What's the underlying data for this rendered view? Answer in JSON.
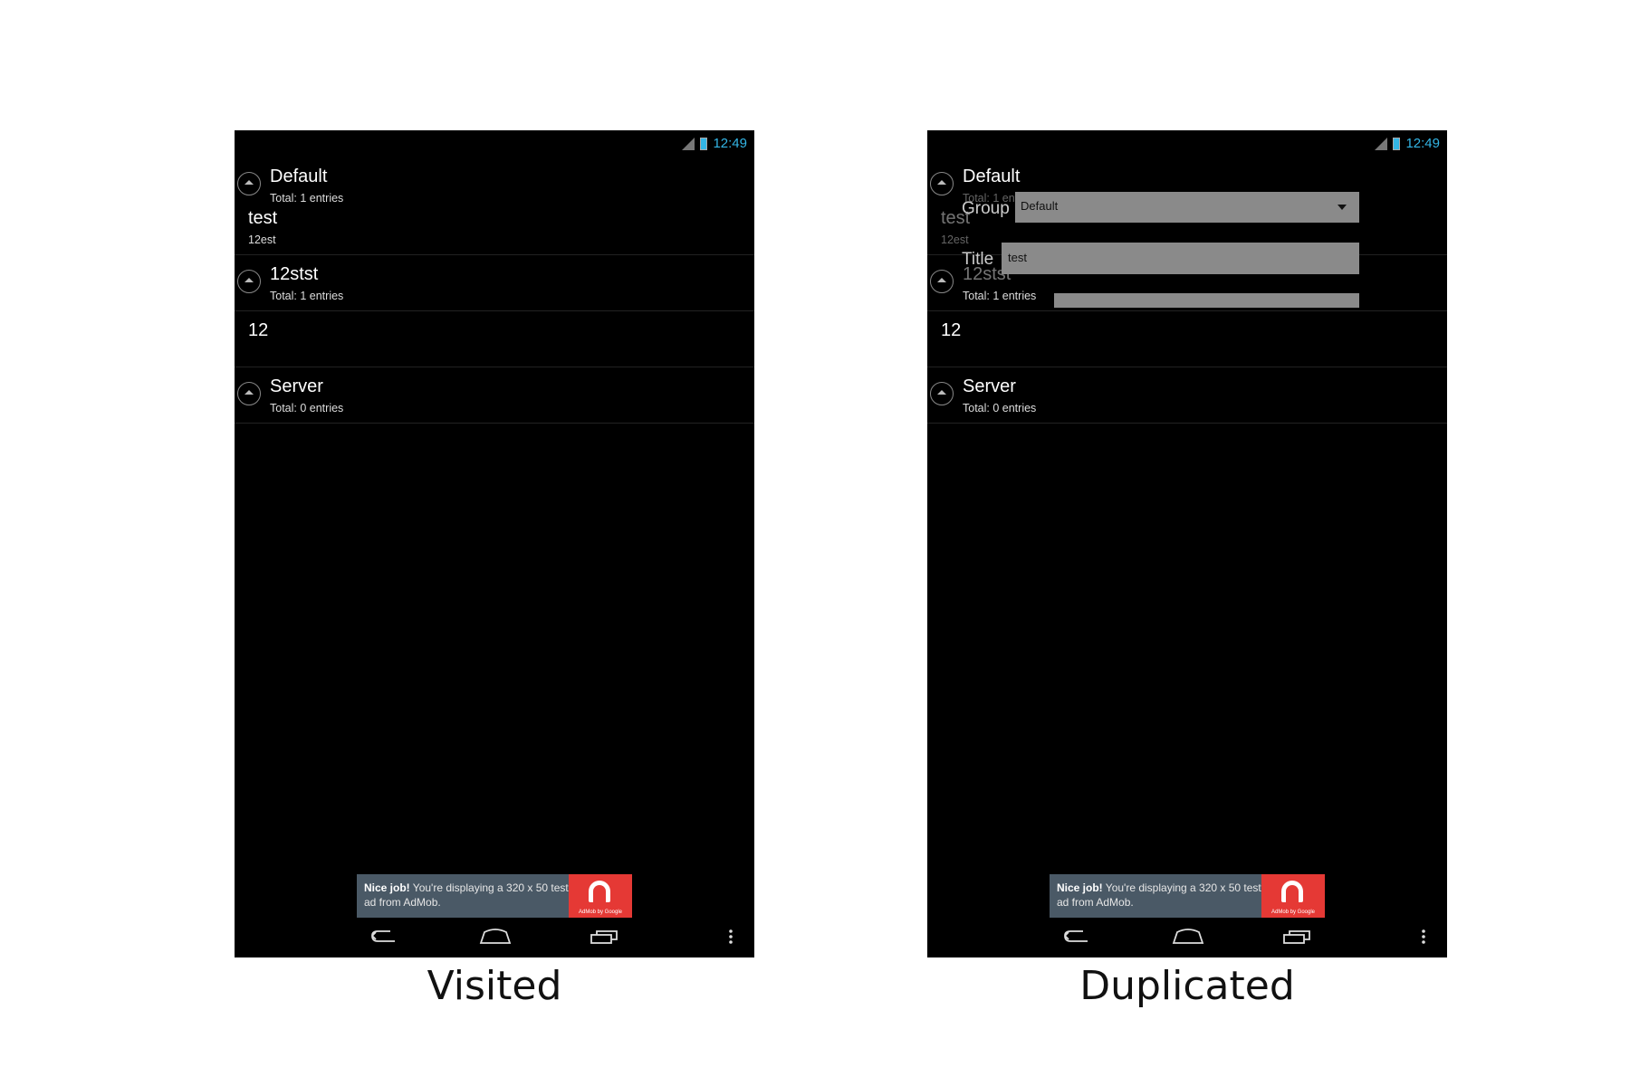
{
  "panels": [
    {
      "caption": "Visited",
      "status": {
        "clock": "12:49"
      },
      "groups": [
        {
          "title": "Default",
          "subtitle": "Total: 1 entries"
        },
        {
          "title": "12stst",
          "subtitle": "Total: 1 entries"
        },
        {
          "title": "Server",
          "subtitle": "Total: 0 entries"
        }
      ],
      "children": [
        {
          "title": "test",
          "subtitle": "12est"
        },
        {
          "title": "12",
          "subtitle": ""
        }
      ],
      "ad": {
        "bold": "Nice job!",
        "text": " You're displaying a 320 x 50 test ad from AdMob.",
        "logo_caption": "AdMob by Google"
      }
    },
    {
      "caption": "Duplicated",
      "status": {
        "clock": "12:49"
      },
      "groups": [
        {
          "title": "Default",
          "subtitle": "Total: 1 entries"
        },
        {
          "title": "12stst",
          "subtitle": "Total: 1 entries"
        },
        {
          "title": "Server",
          "subtitle": "Total: 0 entries"
        }
      ],
      "children": [
        {
          "title": "test",
          "subtitle": "12est"
        },
        {
          "title": "12",
          "subtitle": ""
        }
      ],
      "overlay": {
        "group_label": "Group",
        "group_value": "Default",
        "title_label": "Title",
        "title_value": "test"
      },
      "ad": {
        "bold": "Nice job!",
        "text": " You're displaying a 320 x 50 test ad from AdMob.",
        "logo_caption": "AdMob by Google"
      }
    }
  ]
}
